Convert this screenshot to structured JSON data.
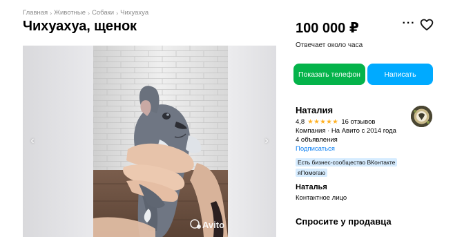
{
  "breadcrumbs": [
    "Главная",
    "Животные",
    "Собаки",
    "Чихуахуа"
  ],
  "title": "Чихуахуа, щенок",
  "price": "100 000 ₽",
  "reply_time": "Отвечает около часа",
  "buttons": {
    "phone": "Показать телефон",
    "write": "Написать"
  },
  "seller": {
    "name": "Наталия",
    "rating": "4,8",
    "stars": "★★★★★",
    "reviews": "16 отзывов",
    "meta": "Компания · На Авито с 2014 года",
    "ads": "4 объявления",
    "subscribe": "Подписаться",
    "tags": [
      "Есть бизнес-сообщество ВКонтакте",
      "яПомогаю"
    ]
  },
  "contact": {
    "name": "Наталья",
    "role": "Контактное лицо"
  },
  "ask_title": "Спросите у продавца",
  "watermark": "Avito",
  "icons": {
    "gallery_prev": "chevron-left-icon",
    "gallery_next": "chevron-right-icon",
    "more": "more-horizontal-icon",
    "favorite": "heart-icon"
  },
  "colors": {
    "phone_button": "#04b34a",
    "write_button": "#00aaff",
    "link": "#0a7ef2",
    "star": "#ffb021",
    "tag_bg": "#d6ecff"
  }
}
